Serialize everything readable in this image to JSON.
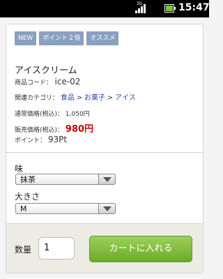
{
  "status_bar": {
    "network": "3G",
    "time": "15:47"
  },
  "product": {
    "badges": [
      "NEW",
      "ポイント２倍",
      "オススメ"
    ],
    "name": "アイスクリーム",
    "code_label": "商品コード：",
    "code_value": "ice-02",
    "category_label": "関連カテゴリ：",
    "categories": [
      "食品",
      "お菓子",
      "アイス"
    ],
    "category_separator": ">",
    "regular_price_label": "通常価格(税込)：",
    "regular_price": "1,050円",
    "sale_price_label": "販売価格(税込)：",
    "sale_price": "980円",
    "points_label": "ポイント：",
    "points": "93Pt"
  },
  "options": {
    "flavor_label": "味",
    "flavor_value": "抹茶",
    "size_label": "大きさ",
    "size_value": "M"
  },
  "cart": {
    "quantity_label": "数量",
    "quantity_value": "1",
    "add_button": "カートに入れる"
  },
  "colors": {
    "badge": "#8aa0bf",
    "sale_price": "#d00000",
    "cart_button": "#7bbb38",
    "category_link": "#2a4aa8"
  }
}
